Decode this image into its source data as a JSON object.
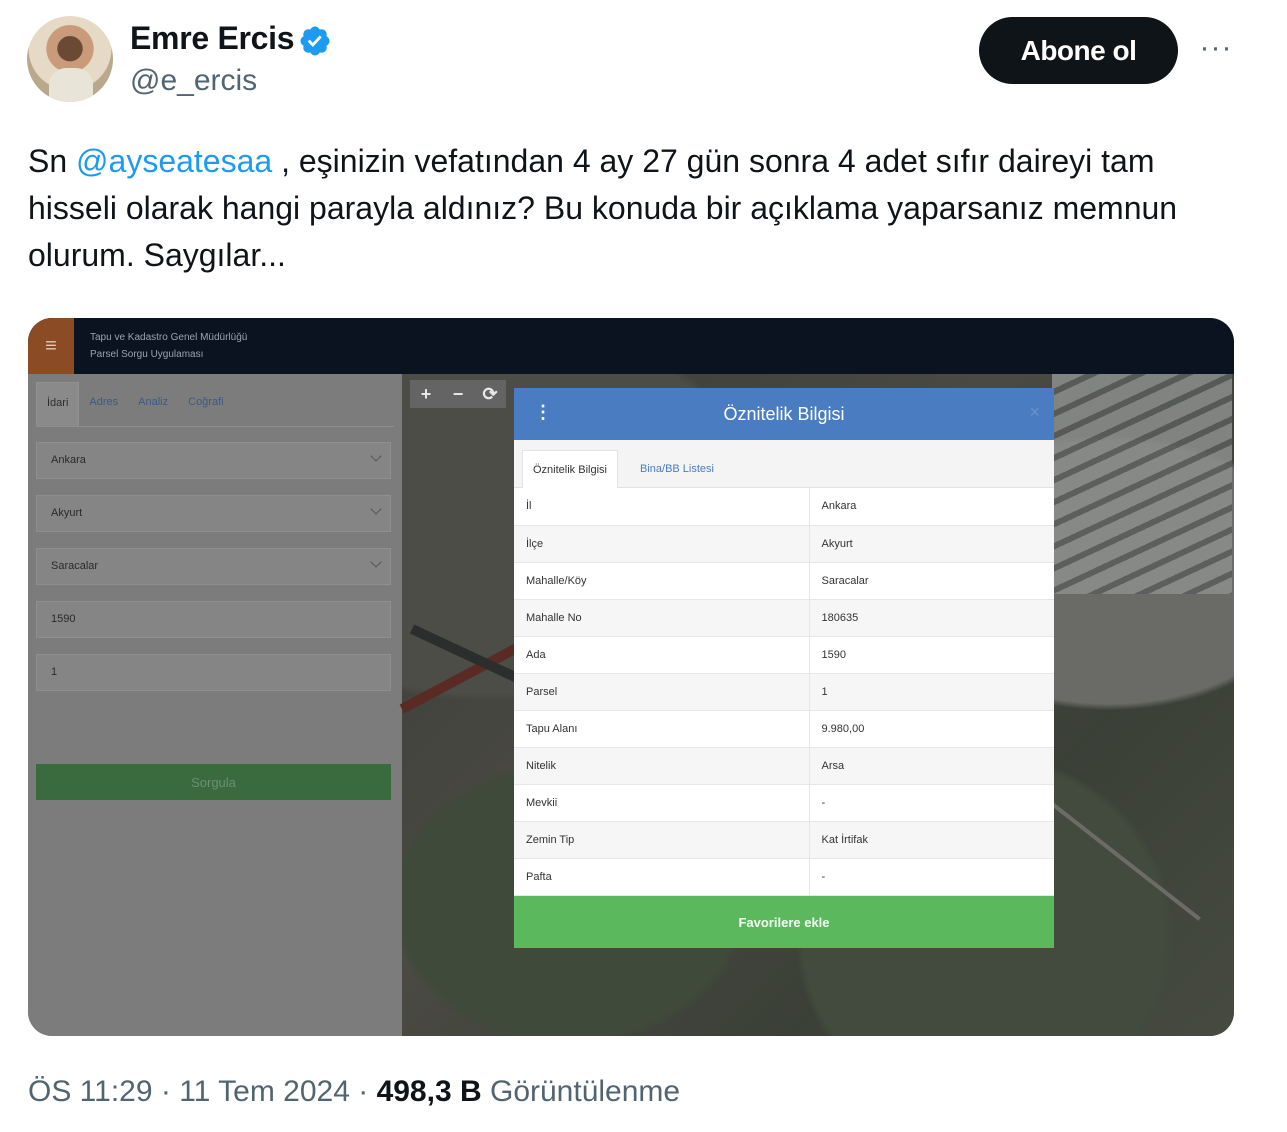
{
  "author": {
    "display_name": "Emre Ercis",
    "handle": "@e_ercis",
    "follow_label": "Abone ol",
    "more_label": "···"
  },
  "tweet": {
    "prefix": "Sn ",
    "mention": "@ayseatesaa",
    "body": " , eşinizin vefatından 4 ay 27 gün sonra 4 adet sıfır daireyi tam hisseli olarak hangi parayla aldınız? Bu konuda bir açıklama yaparsanız memnun olurum. Saygılar..."
  },
  "screenshot": {
    "app_title_1": "Tapu ve Kadastro Genel Müdürlüğü",
    "app_title_2": "Parsel Sorgu Uygulaması",
    "tabs": [
      "İdari",
      "Adres",
      "Analiz",
      "Coğrafi"
    ],
    "fields": [
      "Ankara",
      "Akyurt",
      "Saracalar",
      "1590",
      "1"
    ],
    "query_label": "Sorgula",
    "map_controls": [
      "+",
      "−",
      "⟳"
    ],
    "modal": {
      "menu_icon": "⋮",
      "title": "Öznitelik Bilgisi",
      "close": "×",
      "tab1": "Öznitelik Bilgisi",
      "tab2": "Bina/BB Listesi",
      "rows": [
        {
          "key": "İl",
          "value": "Ankara"
        },
        {
          "key": "İlçe",
          "value": "Akyurt"
        },
        {
          "key": "Mahalle/Köy",
          "value": "Saracalar"
        },
        {
          "key": "Mahalle No",
          "value": "180635"
        },
        {
          "key": "Ada",
          "value": "1590"
        },
        {
          "key": "Parsel",
          "value": "1"
        },
        {
          "key": "Tapu Alanı",
          "value": "9.980,00"
        },
        {
          "key": "Nitelik",
          "value": "Arsa"
        },
        {
          "key": "Mevkii",
          "value": "-"
        },
        {
          "key": "Zemin Tip",
          "value": "Kat İrtifak"
        },
        {
          "key": "Pafta",
          "value": "-"
        }
      ],
      "fav_label": "Favorilere ekle"
    }
  },
  "meta": {
    "time": "ÖS 11:29",
    "date": "11 Tem 2024",
    "sep": " · ",
    "views": "498,3 B",
    "views_label": "Görüntülenme"
  },
  "colors": {
    "verified": "#1d9bf0",
    "mention": "#1d9bf0",
    "modal_header": "#4a7cc2",
    "fav_button": "#5cb85c"
  }
}
